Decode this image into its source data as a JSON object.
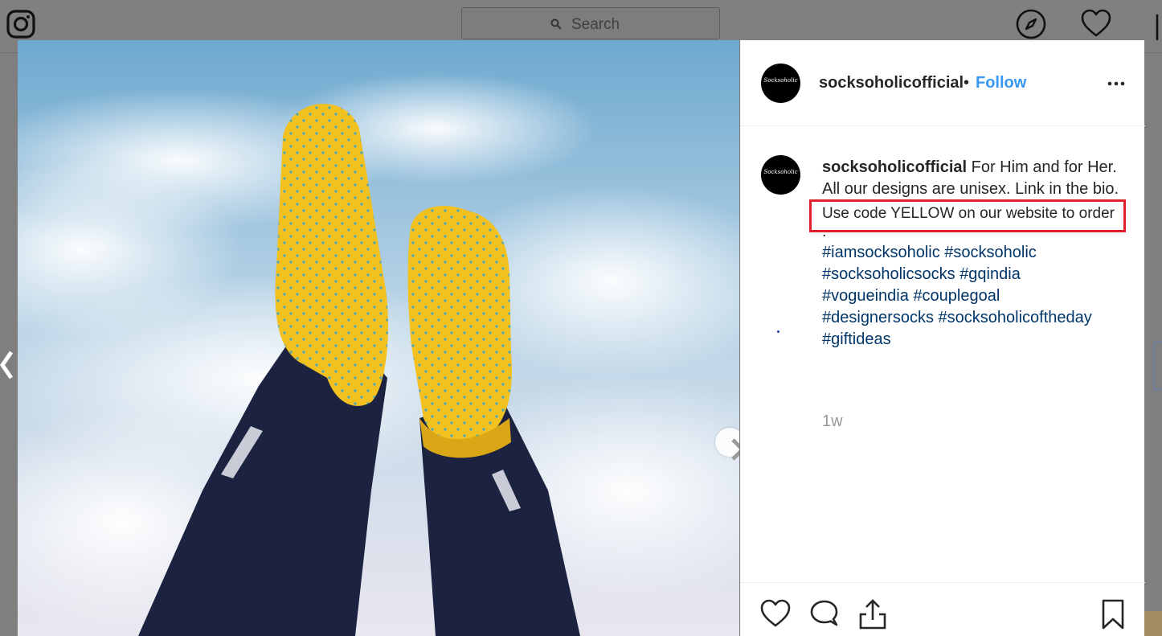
{
  "search": {
    "placeholder": "Search"
  },
  "post": {
    "username": "socksoholicofficial",
    "separator": "•",
    "follow_label": "Follow",
    "avatar_text": "Socksoholic",
    "caption": {
      "username": "socksoholicofficial",
      "text_line1": "For Him and for Her.",
      "text_line2": "All our designs are unisex. Link in the bio.",
      "highlighted": "Use code YELLOW on our website to order",
      "dot": ".",
      "hashtags": [
        "#iamsocksoholic",
        "#socksoholic",
        "#socksoholicsocks",
        "#gqindia",
        "#vogueindia",
        "#couplegoal",
        "#designersocks",
        "#socksoholicoftheday",
        "#giftideas"
      ]
    },
    "time_ago": "1w"
  },
  "icons": {
    "logo": "instagram-logo-icon",
    "search": "search-icon",
    "explore": "compass-icon",
    "activity": "heart-icon",
    "more": "more-options-icon",
    "like": "heart-icon",
    "comment": "comment-icon",
    "share": "share-icon",
    "save": "bookmark-icon",
    "next": "chevron-right-icon",
    "prev": "chevron-left-icon"
  },
  "colors": {
    "follow": "#3897f0",
    "hashtag": "#003569",
    "highlight_border": "#e0202a",
    "sock": "#f2c11f",
    "pants": "#1c2340"
  }
}
